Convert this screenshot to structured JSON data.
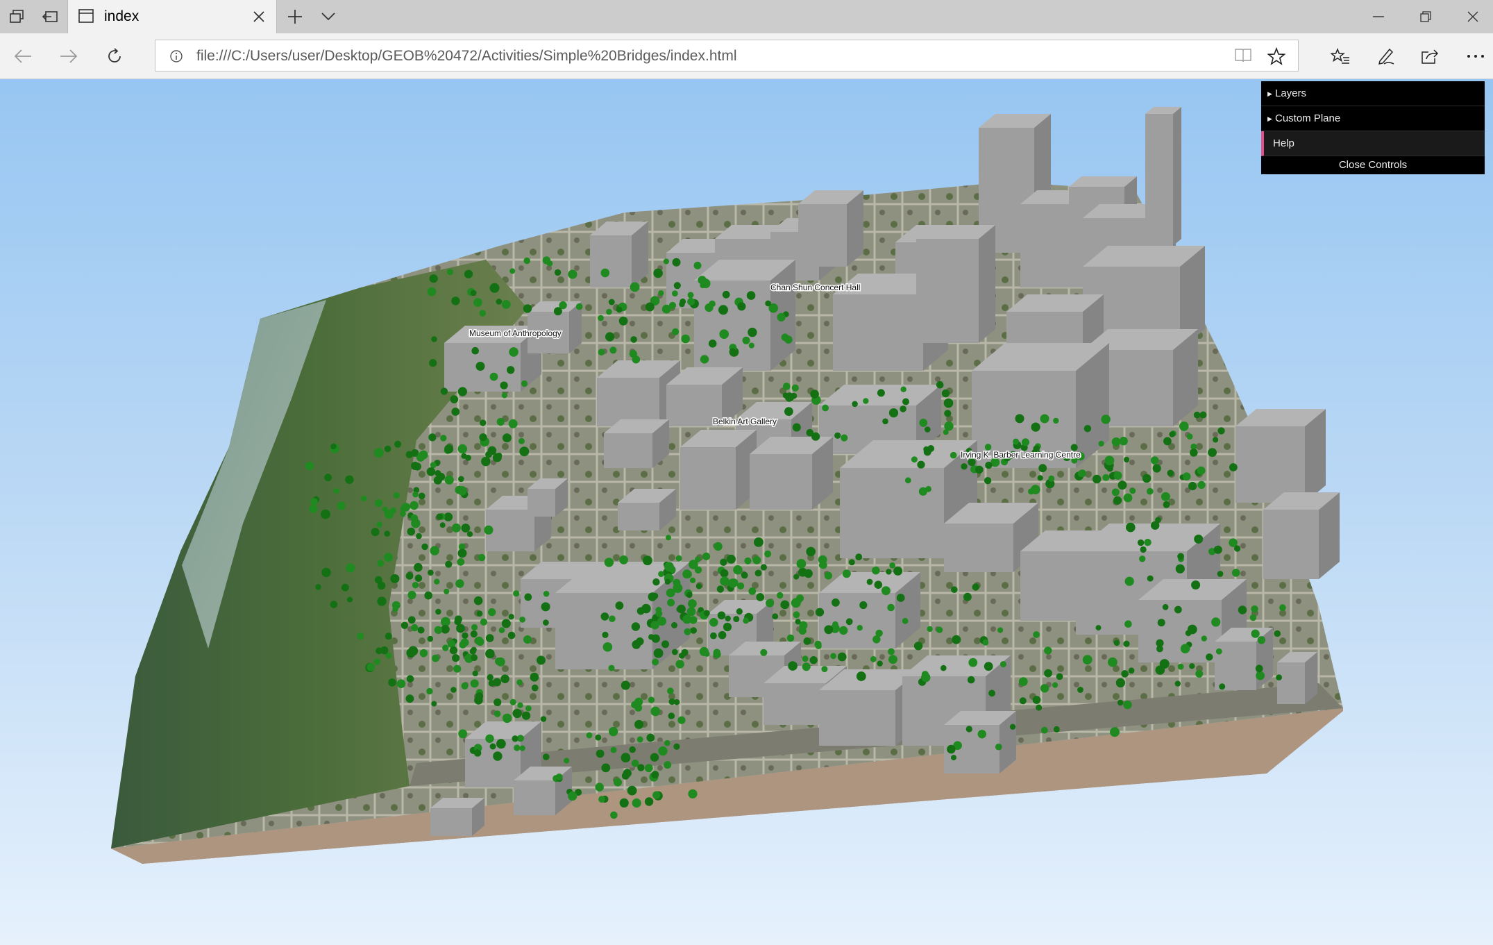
{
  "browser": {
    "tab_title": "index",
    "url": "file:///C:/Users/user/Desktop/GEOB%20472/Activities/Simple%20Bridges/index.html",
    "icons": {
      "tab_actions": "tabs-icon",
      "set_aside": "set-aside-tabs-icon",
      "tab_page": "page-icon",
      "close_tab": "close-icon",
      "new_tab": "plus-icon",
      "tab_list": "chevron-down-icon",
      "back": "back-arrow-icon",
      "forward": "forward-arrow-icon",
      "refresh": "refresh-icon",
      "info": "info-icon",
      "reading_view": "book-icon",
      "favorite": "star-icon",
      "favorites_list": "favorites-icon",
      "notes": "pen-icon",
      "share": "share-icon",
      "more": "more-icon",
      "minimize": "minimize-icon",
      "restore": "restore-icon",
      "close_window": "close-icon"
    }
  },
  "scene": {
    "labels": {
      "museum": "Museum of Anthropology",
      "concert_hall": "Chan Shun Concert Hall",
      "gallery": "Belkin Art Gallery",
      "learning_centre": "Irving K. Barber Learning Centre"
    },
    "colors": {
      "sky_top": "#97c6f2",
      "building": "#9e9e9e",
      "tree": "#1f8a1f",
      "base_side": "#ae9580"
    }
  },
  "controls": {
    "layers": "Layers",
    "custom_plane": "Custom Plane",
    "help": "Help",
    "close": "Close Controls",
    "accent": "#e4508c"
  }
}
